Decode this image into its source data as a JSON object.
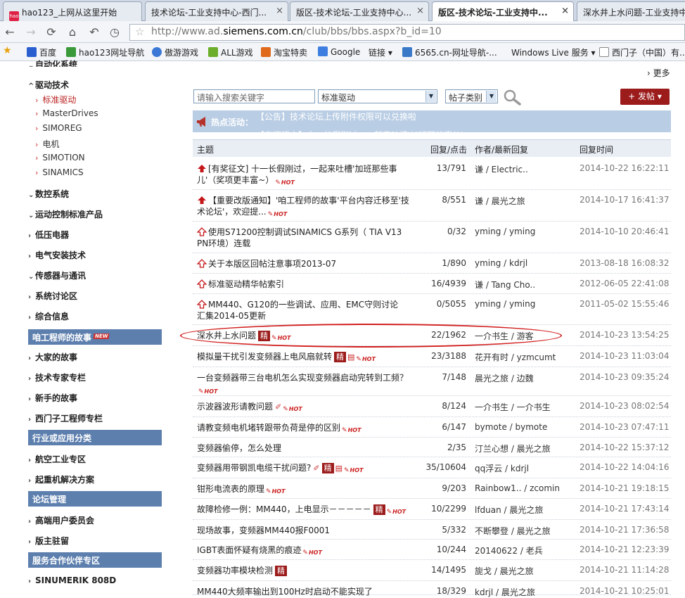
{
  "tabs": [
    {
      "label": "hao123_上网从这里开始",
      "active": false
    },
    {
      "label": "技术论坛-工业支持中心-西门...",
      "active": false
    },
    {
      "label": "版区-技术论坛-工业支持中心...",
      "active": false
    },
    {
      "label": "版区-技术论坛-工业支持中...",
      "active": true
    },
    {
      "label": "深水井上水问题-工业支持中",
      "active": false
    }
  ],
  "url": {
    "prefix": "http://www.ad.",
    "domain": "siemens.com.cn",
    "suffix": "/club/bbs/bbs.aspx?b_id=10"
  },
  "bookmarks": [
    {
      "label": "百度",
      "icon": "paw-icon",
      "color": "#2b5fcf"
    },
    {
      "label": "hao123网址导航",
      "icon": "hao123-icon",
      "color": "#3a9a3a"
    },
    {
      "label": "傲游游戏",
      "icon": "maxthon-icon",
      "color": "#3b78d6"
    },
    {
      "label": "ALL游戏",
      "icon": "game-icon",
      "color": "#6cae2c"
    },
    {
      "label": "淘宝特卖",
      "icon": "taobao-icon",
      "color": "#e06a1b"
    },
    {
      "label": "Google",
      "icon": "google-icon",
      "color": "#3d7ee0"
    },
    {
      "label": "链接 ▾",
      "icon": "",
      "color": ""
    },
    {
      "label": "6565.cn-网址导航-...",
      "icon": "home-icon",
      "color": "#3a78c8"
    },
    {
      "label": "Windows Live 服务 ▾",
      "icon": "",
      "color": ""
    },
    {
      "label": "西门子（中国）有...",
      "icon": "page-icon",
      "color": "#ddd"
    }
  ],
  "sidebar": {
    "top_cut": "自动化系统",
    "drive": "驱动技术",
    "drive_items": [
      "标准驱动",
      "MasterDrives",
      "SIMOREG",
      "电机",
      "SIMOTION",
      "SINAMICS"
    ],
    "groups1": [
      "数控系统",
      "运动控制标准产品",
      "低压电器",
      "电气安装技术",
      "传感器与通讯",
      "系统讨论区",
      "综合信息"
    ],
    "sec_story": "咱工程师的故事",
    "new_tag": "NEW",
    "groups2": [
      "大家的故事",
      "技术专家专栏",
      "新手的故事",
      "西门子工程师专栏"
    ],
    "sec_industry": "行业或应用分类",
    "groups3": [
      "航空工业专区",
      "起重机解决方案"
    ],
    "sec_manage": "论坛管理",
    "groups4": [
      "高端用户委员会",
      "版主驻留"
    ],
    "sec_partner": "服务合作伙伴专区",
    "groups5": [
      "SINUMERIK 808D"
    ]
  },
  "main": {
    "more": "更多",
    "search_placeholder": "请输入搜索关键字",
    "board_select": "标准驱动",
    "type_select": "帖子类别",
    "post_button": "发帖",
    "hot_label": "热点活动：",
    "hot_text": "【公告】技术论坛上传附件权限可以兑换啦",
    "hot_text2": "【有奖征文】十一长假刚过，一起来吐槽'加班那些事儿'",
    "headers": {
      "topic": "主题",
      "reply": "回复/点击",
      "author": "作者/最新回复",
      "time": "回复时间"
    },
    "hot_badge": "HOT",
    "jing_badge": "精",
    "rows": [
      {
        "title": "[有奖征文] 十一长假刚过，一起来吐槽'加班那些事儿'（奖项更丰富~）",
        "reply": "13/791",
        "author": "谦 / Electric..",
        "time": "2014-10-22 16:22:11",
        "pin": "red",
        "hot": true
      },
      {
        "title": "【重要改版通知】'咱工程师的故事'平台内容迁移至'技术论坛'，欢迎提...",
        "reply": "8/551",
        "author": "谦 / 晨光之旅",
        "time": "2014-10-17 16:41:37",
        "pin": "red",
        "hot": true
      },
      {
        "title": "使用S71200控制调试SINAMICS G系列（ TIA V13 PN环境）连载",
        "reply": "0/32",
        "author": "yming / yming",
        "time": "2014-10-10 20:46:41",
        "pin": "outline"
      },
      {
        "title": "关于本版区回帖注意事项2013-07",
        "reply": "1/890",
        "author": "yming / kdrjl",
        "time": "2013-08-18 16:08:32",
        "pin": "outline"
      },
      {
        "title": "标准驱动精华帖索引",
        "reply": "16/4939",
        "author": "谦 / Tang Cho..",
        "time": "2012-06-05 22:41:08",
        "pin": "outline"
      },
      {
        "title": "MM440、G120的一些调试、应用、EMC守则讨论汇集2014-05更新",
        "reply": "0/5055",
        "author": "yming / yming",
        "time": "2011-05-02 15:55:46",
        "pin": "outline"
      },
      {
        "title": "深水井上水问题",
        "reply": "22/1962",
        "author": "一介书生 / 游客",
        "time": "2014-10-23 13:54:25",
        "jing": true,
        "hot": true
      },
      {
        "title": "模拟量干扰引发变频器上电风扇就转",
        "reply": "23/3188",
        "author": "花开有时 / yzmcumt",
        "time": "2014-10-23 11:03:04",
        "jing": true,
        "doc": true,
        "hot": true
      },
      {
        "title": "一台变频器带三台电机怎么实现变频器启动完转到工频？",
        "reply": "7/148",
        "author": "晨光之旅 / 边魏",
        "time": "2014-10-23 09:35:24",
        "hot": true
      },
      {
        "title": "示波器波形请教问题",
        "reply": "8/124",
        "author": "一介书生 / 一介书生",
        "time": "2014-10-23 08:02:54",
        "attach": true,
        "hot": true
      },
      {
        "title": "请教变频电机堵转跟带负荷是停的区别",
        "reply": "6/147",
        "author": "bymote / bymote",
        "time": "2014-10-23 07:47:11",
        "hot": true
      },
      {
        "title": "变频器偷停，怎么处理",
        "reply": "2/35",
        "author": "汀兰心想 / 晨光之旅",
        "time": "2014-10-22 15:37:12"
      },
      {
        "title": "变频器用带钢凯电缆干扰问题?",
        "reply": "35/10604",
        "author": "qq浮云 / kdrjl",
        "time": "2014-10-22 14:04:16",
        "attach": true,
        "jing": true,
        "doc": true,
        "hot": true
      },
      {
        "title": "钳形电流表的原理",
        "reply": "9/203",
        "author": "Rainbow1.. / zcomin",
        "time": "2014-10-21 19:18:15",
        "hot": true
      },
      {
        "title": "故障检修一例：MM440，上电显示－－－－－",
        "reply": "10/2299",
        "author": "lfduan / 晨光之旅",
        "time": "2014-10-21 17:43:14",
        "jing": true,
        "hot": true
      },
      {
        "title": "现场故事，变频器MM440报F0001",
        "reply": "5/332",
        "author": "不断攀登 / 晨光之旅",
        "time": "2014-10-21 17:36:58"
      },
      {
        "title": "IGBT表面怀疑有烧黑的痕迹",
        "reply": "10/244",
        "author": "20140622 / 老兵",
        "time": "2014-10-21 12:23:39",
        "hot": true
      },
      {
        "title": "变频器功率模块检测",
        "reply": "14/1495",
        "author": "旎戈 / 晨光之旅",
        "time": "2014-10-21 11:14:28",
        "jing": true
      },
      {
        "title": "MM440大频率输出到100Hz时启动不能实现了",
        "reply": "18/329",
        "author": "kdrjl / 晨光之旅",
        "time": "2014-10-21 10:25:01"
      }
    ]
  }
}
